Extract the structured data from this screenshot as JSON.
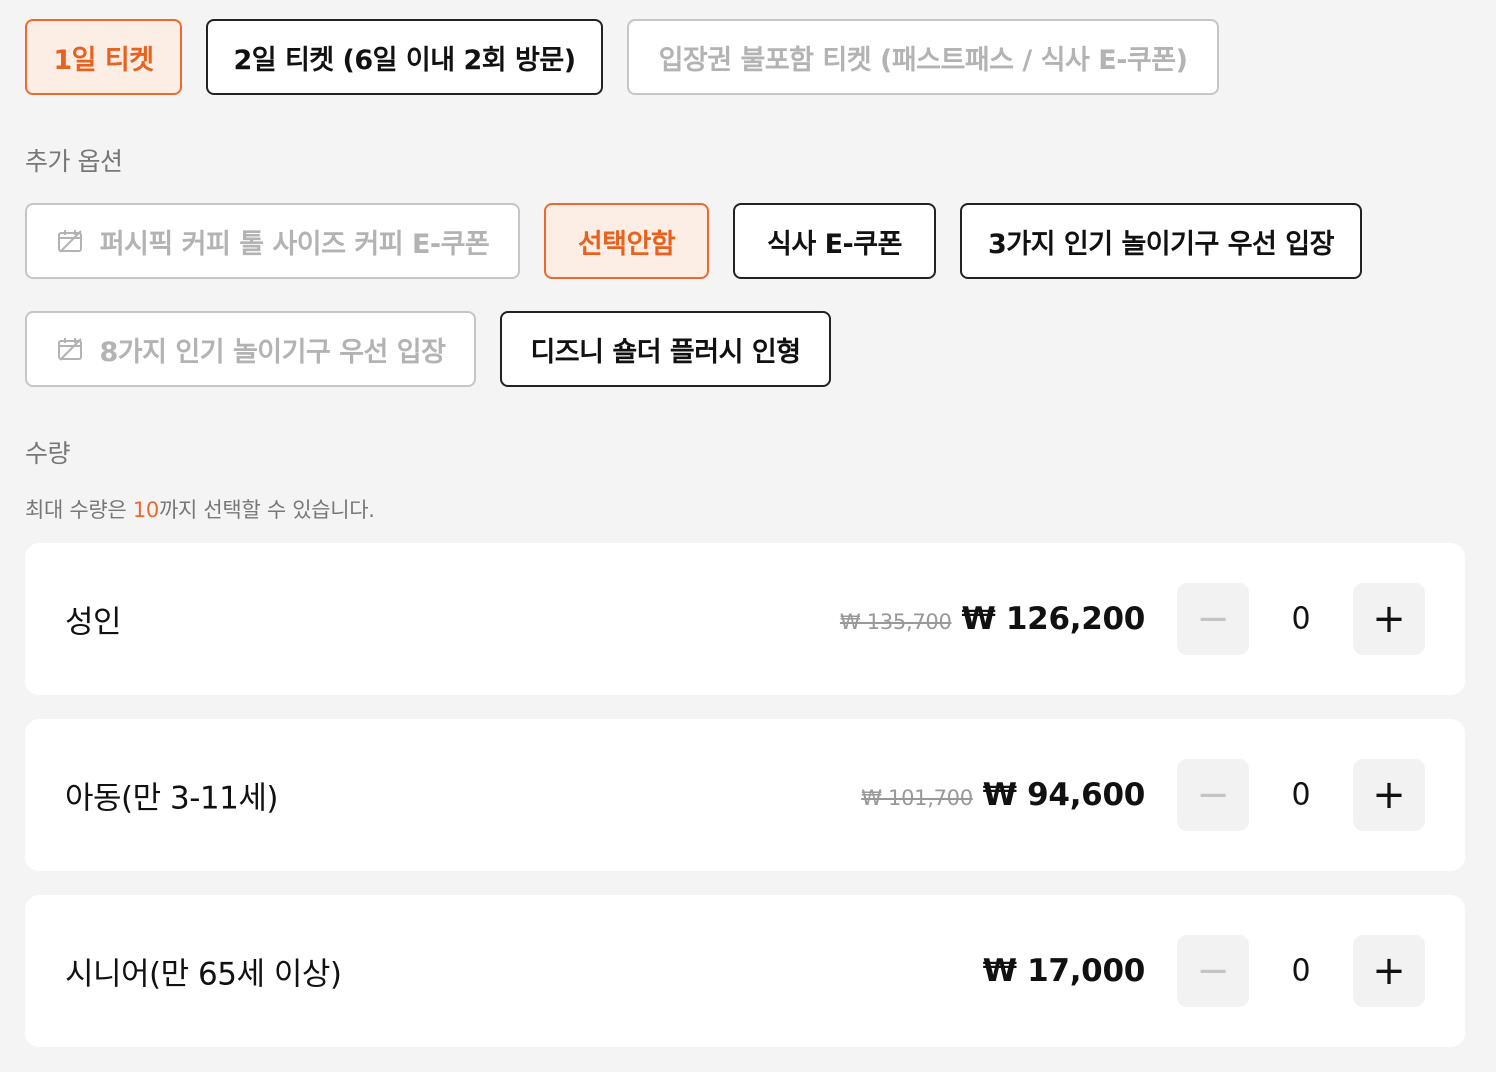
{
  "ticket_types": [
    {
      "label": "1일 티켓",
      "state": "selected"
    },
    {
      "label": "2일 티켓 (6일 이내 2회 방문)",
      "state": "normal"
    },
    {
      "label": "입장권 불포함 티켓 (패스트패스 / 식사 E-쿠폰)",
      "state": "disabled"
    }
  ],
  "options": {
    "title": "추가 옵션",
    "items": [
      {
        "label": "퍼시픽 커피 톨 사이즈 커피 E-쿠폰",
        "state": "disabled",
        "icon": "calendar-unavailable-icon"
      },
      {
        "label": "선택안함",
        "state": "selected"
      },
      {
        "label": "식사 E-쿠폰",
        "state": "normal"
      },
      {
        "label": "3가지 인기 놀이기구 우선 입장",
        "state": "normal"
      },
      {
        "label": "8가지 인기 놀이기구 우선 입장",
        "state": "disabled",
        "icon": "calendar-unavailable-icon"
      },
      {
        "label": "디즈니 숄더 플러시 인형",
        "state": "normal"
      }
    ]
  },
  "quantity": {
    "title": "수량",
    "hint_prefix": "최대 수량은 ",
    "hint_max": "10",
    "hint_suffix": "까지 선택할 수 있습니다.",
    "rows": [
      {
        "name": "성인",
        "original_price": "₩ 135,700",
        "price": "₩ 126,200",
        "count": "0"
      },
      {
        "name": "아동(만 3-11세)",
        "original_price": "₩ 101,700",
        "price": "₩ 94,600",
        "count": "0"
      },
      {
        "name": "시니어(만 65세 이상)",
        "original_price": "",
        "price": "₩ 17,000",
        "count": "0"
      }
    ],
    "minus_symbol": "−",
    "plus_symbol": "+"
  },
  "colors": {
    "accent": "#ec6a2e",
    "selected_bg": "#fdeee5",
    "disabled_border": "#c6c6c6",
    "disabled_text": "#b3b3b3",
    "page_bg": "#f4f4f4"
  }
}
